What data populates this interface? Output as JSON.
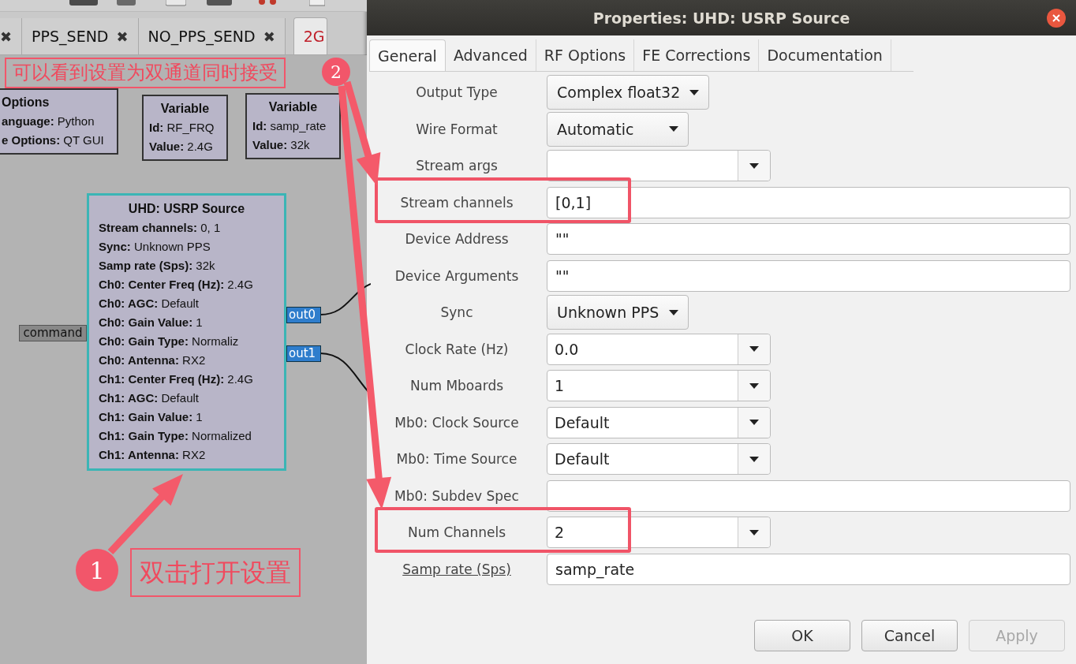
{
  "canvas_tabs": [
    {
      "close": "✖",
      "selected": false
    },
    {
      "label": "PPS_SEND",
      "close": "✖",
      "selected": false
    },
    {
      "label": "NO_PPS_SEND",
      "close": "✖",
      "selected": false
    },
    {
      "label": "2G",
      "selected": true
    }
  ],
  "blocks": [
    {
      "kind": "options",
      "selected": false,
      "title": "Options",
      "lines": [
        "**anguage:** Python",
        "**e Options:** QT GUI"
      ]
    },
    {
      "kind": "variable",
      "selected": false,
      "title": "Variable",
      "lines": [
        "**Id:** RF_FRQ",
        "**Value:** 2.4G"
      ]
    },
    {
      "kind": "variable",
      "selected": false,
      "title": "Variable",
      "lines": [
        "**Id:** samp_rate",
        "**Value:** 32k"
      ]
    },
    {
      "kind": "source",
      "selected": true,
      "title": "UHD: USRP Source",
      "lines": [
        "**Stream channels:** 0, 1",
        "**Sync:** Unknown PPS",
        "**Samp rate (Sps):** 32k",
        "**Ch0: Center Freq (Hz):** 2.4G",
        "**Ch0: AGC:** Default",
        "**Ch0: Gain Value:** 1",
        "**Ch0: Gain Type:** Normaliz",
        "**Ch0: Antenna:** RX2",
        "**Ch1: Center Freq (Hz):** 2.4G",
        "**Ch1: AGC:** Default",
        "**Ch1: Gain Value:** 1",
        "**Ch1: Gain Type:** Normalized",
        "**Ch1: Antenna:** RX2"
      ],
      "input_port": "command",
      "output_ports": [
        "out0",
        "out1"
      ]
    }
  ],
  "dialog": {
    "title": "Properties: UHD: USRP Source",
    "tabs": [
      {
        "label": "General",
        "selected": true
      },
      {
        "label": "Advanced",
        "selected": false
      },
      {
        "label": "RF Options",
        "selected": false
      },
      {
        "label": "FE Corrections",
        "selected": false
      },
      {
        "label": "Documentation",
        "selected": false
      }
    ],
    "fields": [
      {
        "label": "Output Type",
        "kind": "dropdown",
        "value": "Complex float32",
        "highlighted": false,
        "underlined": false
      },
      {
        "label": "Wire Format",
        "kind": "dropdown",
        "value": "Automatic",
        "highlighted": false,
        "underlined": false
      },
      {
        "label": "Stream args",
        "kind": "combo",
        "highlighted": false,
        "underlined": false
      },
      {
        "label": "Stream channels",
        "kind": "entry",
        "value": "[0,1]",
        "highlighted": true,
        "underlined": false
      },
      {
        "label": "Device Address",
        "kind": "entry",
        "value": "\"\"",
        "highlighted": false,
        "underlined": false
      },
      {
        "label": "Device Arguments",
        "kind": "entry",
        "value": "\"\"",
        "highlighted": false,
        "underlined": false
      },
      {
        "label": "Sync",
        "kind": "dropdown",
        "value": "Unknown PPS",
        "highlighted": false,
        "underlined": false
      },
      {
        "label": "Clock Rate (Hz)",
        "kind": "combo",
        "value": "0.0",
        "highlighted": false,
        "underlined": false
      },
      {
        "label": "Num Mboards",
        "kind": "combo",
        "value": "1",
        "highlighted": false,
        "underlined": false
      },
      {
        "label": "Mb0: Clock Source",
        "kind": "combo",
        "value": "Default",
        "highlighted": false,
        "underlined": false
      },
      {
        "label": "Mb0: Time Source",
        "kind": "combo",
        "value": "Default",
        "highlighted": false,
        "underlined": false
      },
      {
        "label": "Mb0: Subdev Spec",
        "kind": "entry",
        "highlighted": false,
        "underlined": false
      },
      {
        "label": "Num Channels",
        "kind": "combo",
        "value": "2",
        "highlighted": true,
        "underlined": false
      },
      {
        "label": "Samp rate (Sps)",
        "kind": "entry",
        "value": "samp_rate",
        "highlighted": false,
        "underlined": true
      }
    ],
    "buttons": [
      {
        "label": "OK",
        "disabled": false
      },
      {
        "label": "Cancel",
        "disabled": false
      },
      {
        "label": "Apply",
        "disabled": true
      }
    ]
  },
  "annotations": [
    {
      "number": "2",
      "text": "可以看到设置为双通道同时接受"
    },
    {
      "number": "1",
      "text": "双击打开设置"
    }
  ]
}
